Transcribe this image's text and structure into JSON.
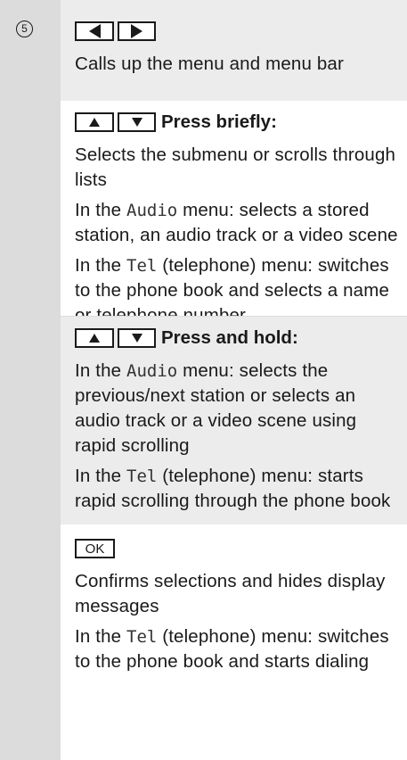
{
  "item_number": "5",
  "section1": {
    "keys": [
      "left-arrow-icon",
      "right-arrow-icon"
    ],
    "description": "Calls up the menu and menu bar"
  },
  "section2": {
    "keys": [
      "up-arrow-icon",
      "down-arrow-icon"
    ],
    "label": "Press briefly:",
    "para1": "Selects the submenu or scrolls through lists",
    "para2_prefix": "In the ",
    "para2_mono": "Audio",
    "para2_suffix": " menu: selects a stored station, an audio track or a video scene",
    "para3_prefix": "In the ",
    "para3_mono": "Tel",
    "para3_suffix": " (telephone) menu: switches to the phone book and selects a name or telephone number"
  },
  "section3": {
    "keys": [
      "up-arrow-icon",
      "down-arrow-icon"
    ],
    "label": "Press and hold:",
    "para1_prefix": "In the ",
    "para1_mono": "Audio",
    "para1_suffix": " menu: selects the previous/next station or selects an audio track or a video scene using rapid scrolling",
    "para2_prefix": "In the ",
    "para2_mono": "Tel",
    "para2_suffix": " (telephone) menu: starts rapid scrolling through the phone book"
  },
  "section4": {
    "key_label": "OK",
    "para1": "Confirms selections and hides display messages",
    "para2_prefix": "In the ",
    "para2_mono": "Tel",
    "para2_suffix": " (telephone) menu: switches to the phone book and starts dialing"
  },
  "colors": {
    "left_column": "#dcdcdc",
    "row_gray": "#ececec",
    "row_white": "#ffffff",
    "text": "#1a1a1a"
  }
}
